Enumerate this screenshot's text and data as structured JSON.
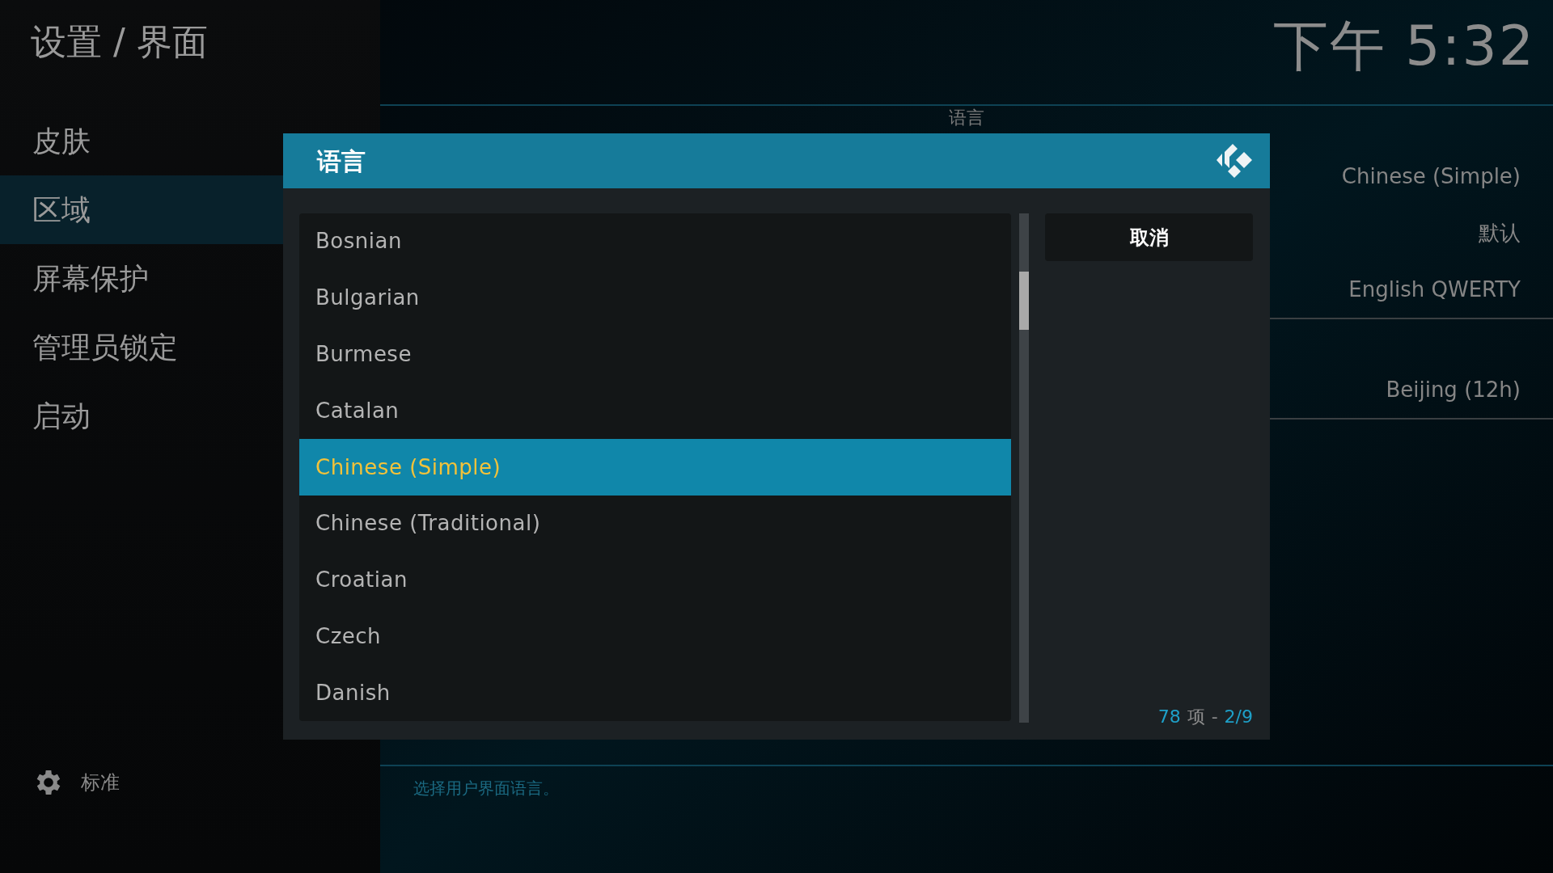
{
  "header": {
    "breadcrumb": "设置 / 界面",
    "clock": "下午 5:32"
  },
  "sidebar": {
    "items": [
      {
        "label": "皮肤",
        "selected": false
      },
      {
        "label": "区域",
        "selected": true
      },
      {
        "label": "屏幕保护",
        "selected": false
      },
      {
        "label": "管理员锁定",
        "selected": false
      },
      {
        "label": "启动",
        "selected": false
      }
    ],
    "settings_level": "标准"
  },
  "settings": {
    "section_label": "语言",
    "groups": [
      {
        "values": [
          "Chinese (Simple)",
          "默认",
          "English QWERTY"
        ]
      },
      {
        "values": [
          "Beijing (12h)"
        ]
      }
    ]
  },
  "dialog": {
    "title": "语言",
    "items": [
      {
        "label": "Bosnian",
        "selected": false
      },
      {
        "label": "Bulgarian",
        "selected": false
      },
      {
        "label": "Burmese",
        "selected": false
      },
      {
        "label": "Catalan",
        "selected": false
      },
      {
        "label": "Chinese (Simple)",
        "selected": true
      },
      {
        "label": "Chinese (Traditional)",
        "selected": false
      },
      {
        "label": "Croatian",
        "selected": false
      },
      {
        "label": "Czech",
        "selected": false
      },
      {
        "label": "Danish",
        "selected": false
      }
    ],
    "cancel_button": "取消",
    "count": "78",
    "count_unit": "项",
    "separator": "-",
    "page": "2/9"
  },
  "description": "选择用户界面语言。"
}
